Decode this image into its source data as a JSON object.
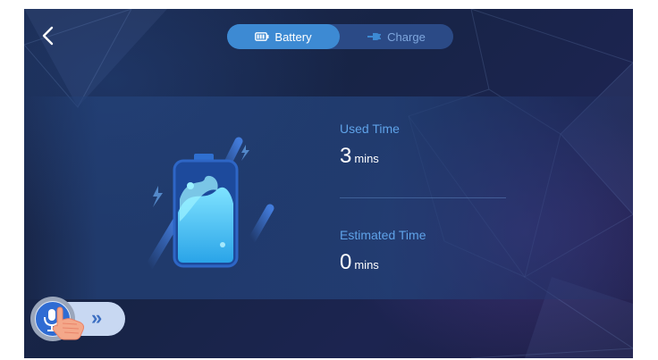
{
  "tabs": {
    "battery_label": "Battery",
    "charge_label": "Charge",
    "active": "Battery"
  },
  "stats": {
    "used_time_label": "Used Time",
    "used_time_value": "3",
    "used_time_unit": "mins",
    "estimated_time_label": "Estimated Time",
    "estimated_time_value": "0",
    "estimated_time_unit": "mins"
  },
  "icons": {
    "back": "chevron-left-icon",
    "battery_tab": "battery-icon",
    "charge_tab": "plug-icon",
    "illustration": "battery-illustration-icon",
    "voice": "microphone-icon",
    "hand": "hand-icon",
    "expand": "double-chevron-right-icon"
  },
  "colors": {
    "accent": "#3d8ad3",
    "label_blue": "#5fa2e8",
    "background": "#1b2a4e"
  }
}
